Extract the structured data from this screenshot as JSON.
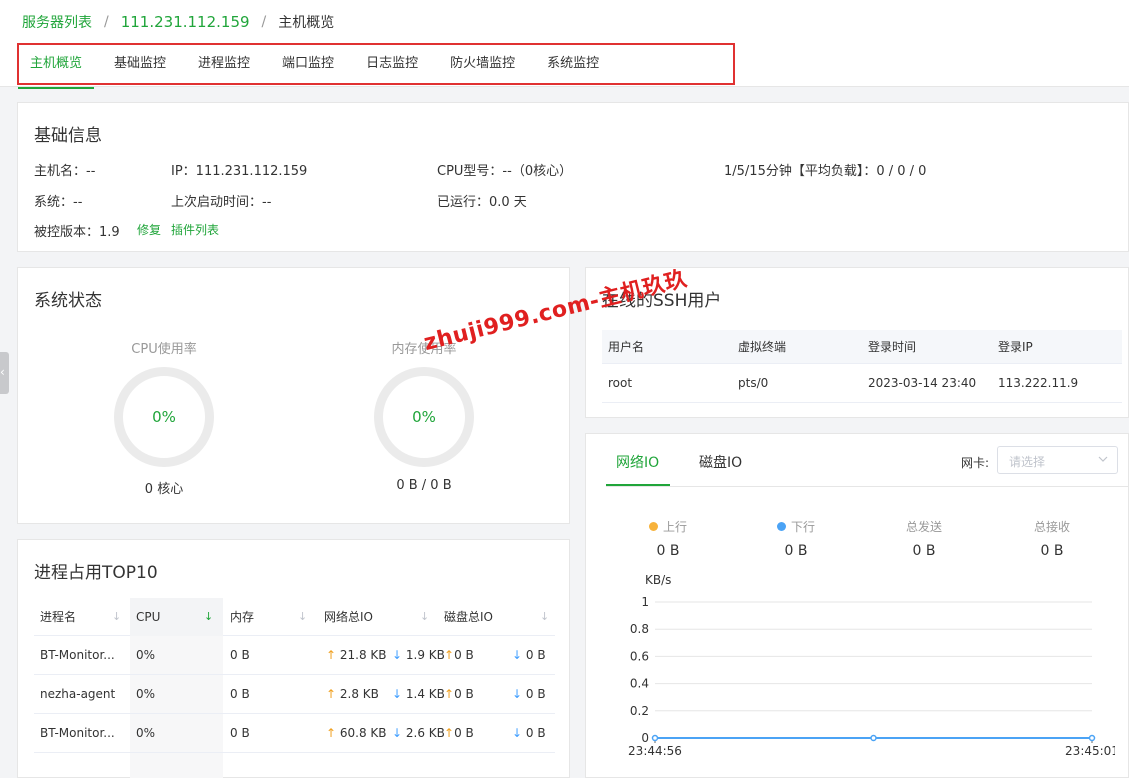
{
  "breadcrumb": {
    "server_list": "服务器列表",
    "sep": "/",
    "ip": "111.231.112.159",
    "current": "主机概览"
  },
  "tabs": [
    {
      "label": "主机概览",
      "active": true
    },
    {
      "label": "基础监控"
    },
    {
      "label": "进程监控"
    },
    {
      "label": "端口监控"
    },
    {
      "label": "日志监控"
    },
    {
      "label": "防火墙监控"
    },
    {
      "label": "系统监控"
    }
  ],
  "basic": {
    "title": "基础信息",
    "hostname": "主机名：--",
    "ip": "IP：111.231.112.159",
    "cpu_model": "CPU型号：--（0核心）",
    "load": "1/5/15分钟【平均负载】：0 / 0 / 0",
    "system": "系统：--",
    "boot_time": "上次启动时间：--",
    "uptime": "已运行：0.0 天",
    "agent_version": "被控版本：1.9",
    "repair": "修复",
    "plugin_list": "插件列表"
  },
  "status": {
    "title": "系统状态",
    "cpu_label": "CPU使用率",
    "cpu_value": "0%",
    "cpu_sub": "0 核心",
    "mem_label": "内存使用率",
    "mem_value": "0%",
    "mem_sub": "0 B / 0 B"
  },
  "ssh": {
    "title": "在线的SSH用户",
    "columns": [
      "用户名",
      "虚拟终端",
      "登录时间",
      "登录IP"
    ],
    "rows": [
      {
        "user": "root",
        "tty": "pts/0",
        "time": "2023-03-14 23:40",
        "ip": "113.222.11.9"
      }
    ]
  },
  "io": {
    "tab_net": "网络IO",
    "tab_disk": "磁盘IO",
    "nic_label": "网卡:",
    "nic_placeholder": "请选择",
    "stats": [
      {
        "label": "上行",
        "value": "0 B",
        "color": "#f7b23b"
      },
      {
        "label": "下行",
        "value": "0 B",
        "color": "#4ba3f5"
      },
      {
        "label": "总发送",
        "value": "0 B"
      },
      {
        "label": "总接收",
        "value": "0 B"
      }
    ]
  },
  "chart_data": {
    "type": "line",
    "ylabel": "KB/s",
    "ylim": [
      0,
      1
    ],
    "yticks": [
      "0",
      "0.2",
      "0.4",
      "0.6",
      "0.8",
      "1"
    ],
    "x": [
      "23:44:56",
      "",
      "23:45:01"
    ],
    "series": [
      {
        "values": [
          0,
          0,
          0
        ],
        "color": "#4ba3f5"
      }
    ],
    "grid": true
  },
  "proc": {
    "title": "进程占用TOP10",
    "columns": [
      "进程名",
      "CPU",
      "内存",
      "网络总IO",
      "磁盘总IO"
    ],
    "rows": [
      {
        "name": "BT-Monitor...",
        "cpu": "0%",
        "mem": "0 B",
        "net_up": "21.8 KB",
        "net_down": "1.9 KB",
        "disk_up": "0 B",
        "disk_down": "0 B"
      },
      {
        "name": "nezha-agent",
        "cpu": "0%",
        "mem": "0 B",
        "net_up": "2.8 KB",
        "net_down": "1.4 KB",
        "disk_up": "0 B",
        "disk_down": "0 B"
      },
      {
        "name": "BT-Monitor...",
        "cpu": "0%",
        "mem": "0 B",
        "net_up": "60.8 KB",
        "net_down": "2.6 KB",
        "disk_up": "0 B",
        "disk_down": "0 B"
      }
    ]
  },
  "watermark": "zhuji999.com-主机玖玖"
}
